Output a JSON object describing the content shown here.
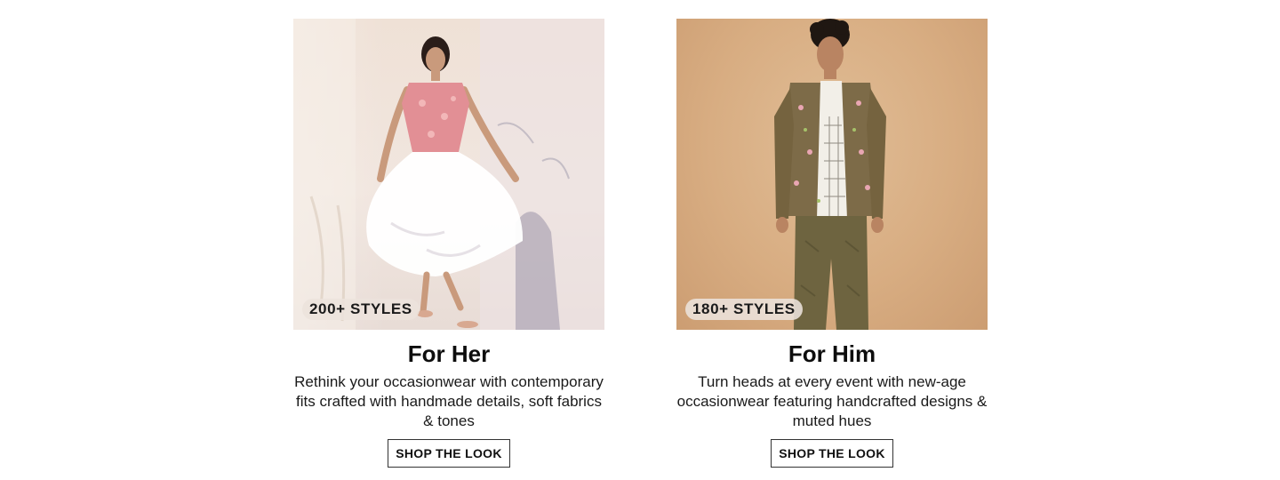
{
  "cards": [
    {
      "badge": "200+ STYLES",
      "title": "For Her",
      "description": "Rethink your occasionwear with contemporary fits crafted with handmade details, soft fabrics & tones",
      "button_label": "SHOP THE LOOK"
    },
    {
      "badge": "180+ STYLES",
      "title": "For Him",
      "description": "Turn heads at every event with new-age occasionwear featuring handcrafted designs & muted hues",
      "button_label": "SHOP THE LOOK"
    }
  ],
  "colors": {
    "her_background": "#efe1d6",
    "him_background": "#d8ad82",
    "badge_background": "#ece2dc",
    "button_border": "#333333"
  }
}
